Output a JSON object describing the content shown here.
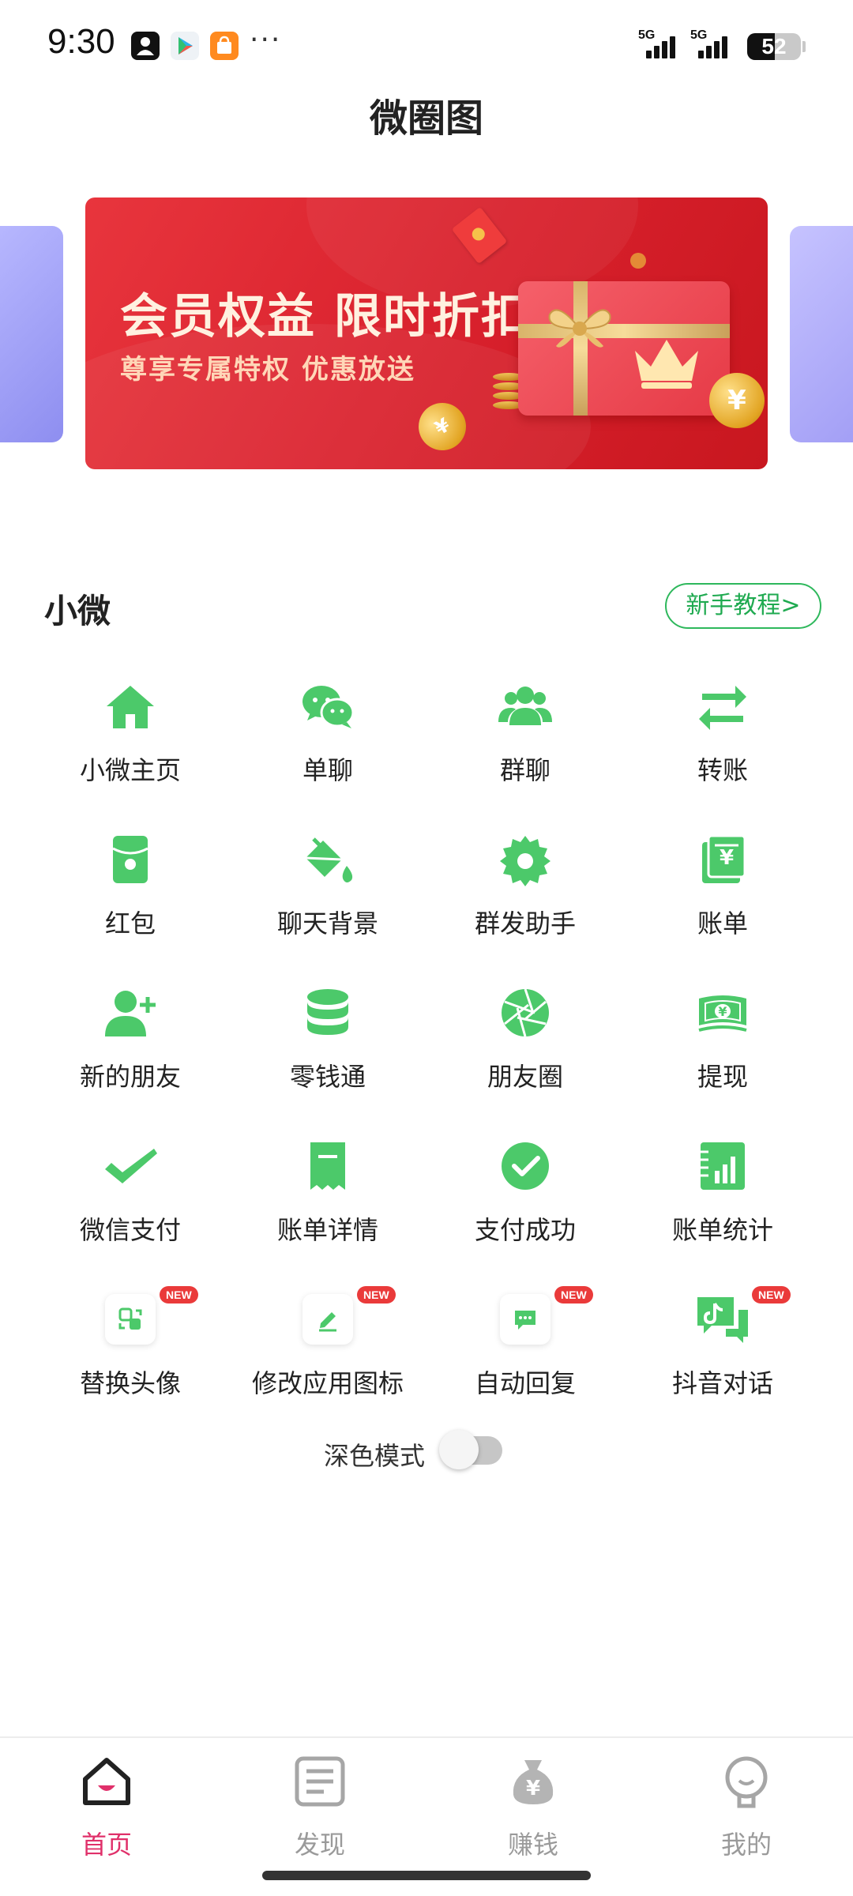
{
  "status_bar": {
    "time": "9:30",
    "more": "···",
    "signal_1": "5G",
    "signal_2": "5G",
    "battery": "52",
    "battery_level": 0.52,
    "app_icons": [
      "contacts-app-icon",
      "play-store-icon",
      "shopping-app-icon"
    ]
  },
  "header": {
    "title": "微圈图"
  },
  "banner": {
    "title": "会员权益 限时折扣",
    "subtitle": "尊享专属特权 优惠放送",
    "coin_symbol": "¥"
  },
  "section": {
    "title": "小微",
    "tutorial_label": "新手教程>"
  },
  "features": [
    {
      "label": "小微主页",
      "icon": "home-icon",
      "badge": ""
    },
    {
      "label": "单聊",
      "icon": "wechat-icon",
      "badge": ""
    },
    {
      "label": "群聊",
      "icon": "group-icon",
      "badge": ""
    },
    {
      "label": "转账",
      "icon": "transfer-icon",
      "badge": ""
    },
    {
      "label": "红包",
      "icon": "red-packet-icon",
      "badge": ""
    },
    {
      "label": "聊天背景",
      "icon": "paint-bucket-icon",
      "badge": ""
    },
    {
      "label": "群发助手",
      "icon": "gear-icon",
      "badge": ""
    },
    {
      "label": "账单",
      "icon": "bill-icon",
      "badge": ""
    },
    {
      "label": "新的朋友",
      "icon": "add-friend-icon",
      "badge": ""
    },
    {
      "label": "零钱通",
      "icon": "coins-stack-icon",
      "badge": ""
    },
    {
      "label": "朋友圈",
      "icon": "aperture-icon",
      "badge": ""
    },
    {
      "label": "提现",
      "icon": "cash-icon",
      "badge": ""
    },
    {
      "label": "微信支付",
      "icon": "checkmark-icon",
      "badge": ""
    },
    {
      "label": "账单详情",
      "icon": "receipt-icon",
      "badge": ""
    },
    {
      "label": "支付成功",
      "icon": "check-circle-icon",
      "badge": ""
    },
    {
      "label": "账单统计",
      "icon": "statistics-icon",
      "badge": ""
    },
    {
      "label": "替换头像",
      "icon": "swap-avatar-icon",
      "badge": "NEW"
    },
    {
      "label": "修改应用图标",
      "icon": "edit-icon",
      "badge": "NEW"
    },
    {
      "label": "自动回复",
      "icon": "chat-bubble-icon",
      "badge": "NEW"
    },
    {
      "label": "抖音对话",
      "icon": "tiktok-chat-icon",
      "badge": "NEW"
    }
  ],
  "dark_mode": {
    "label": "深色模式",
    "enabled": false
  },
  "bottom_nav": [
    {
      "label": "首页",
      "icon": "home-smile-icon",
      "active": true
    },
    {
      "label": "发现",
      "icon": "document-icon",
      "active": false
    },
    {
      "label": "赚钱",
      "icon": "money-bag-icon",
      "active": false
    },
    {
      "label": "我的",
      "icon": "profile-icon",
      "active": false
    }
  ],
  "colors": {
    "accent_green": "#4cc96a",
    "tutorial_green": "#1faa50",
    "nav_active": "#e0306a",
    "banner_red": "#d8202c",
    "badge_red": "#ea3a3a"
  }
}
